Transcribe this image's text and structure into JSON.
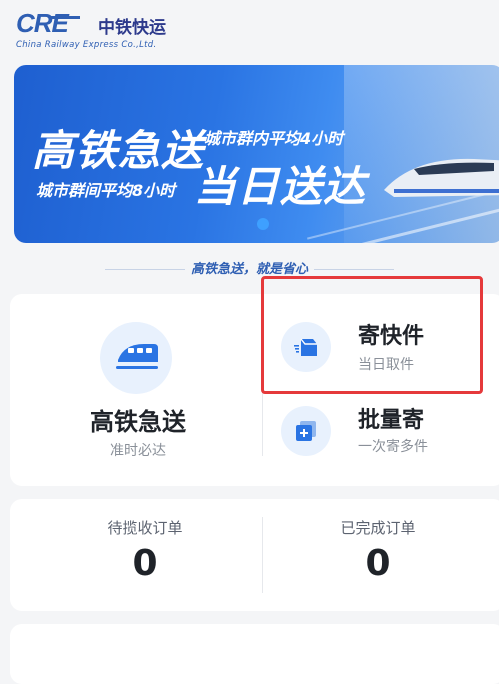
{
  "header": {
    "logo_mark": "CRE",
    "logo_cn": "中铁快运",
    "logo_en": "China Railway Express Co.,Ltd."
  },
  "banner": {
    "title1": "高铁急送",
    "title2": "当日送达",
    "sub1": "城市群内平均4小时",
    "sub2": "城市群间平均8小时"
  },
  "slogan": "高铁急送，就是省心",
  "services": {
    "high_speed": {
      "title": "高铁急送",
      "subtitle": "准时必达",
      "icon": "train-icon"
    },
    "send_express": {
      "title": "寄快件",
      "subtitle": "当日取件",
      "icon": "package-icon"
    },
    "batch_send": {
      "title": "批量寄",
      "subtitle": "一次寄多件",
      "icon": "batch-add-icon"
    }
  },
  "orders": {
    "pending": {
      "label": "待揽收订单",
      "value": "0"
    },
    "completed": {
      "label": "已完成订单",
      "value": "0"
    }
  },
  "colors": {
    "brand": "#2f5fb3",
    "accent": "#2a74e3",
    "highlight": "#e5393b"
  }
}
